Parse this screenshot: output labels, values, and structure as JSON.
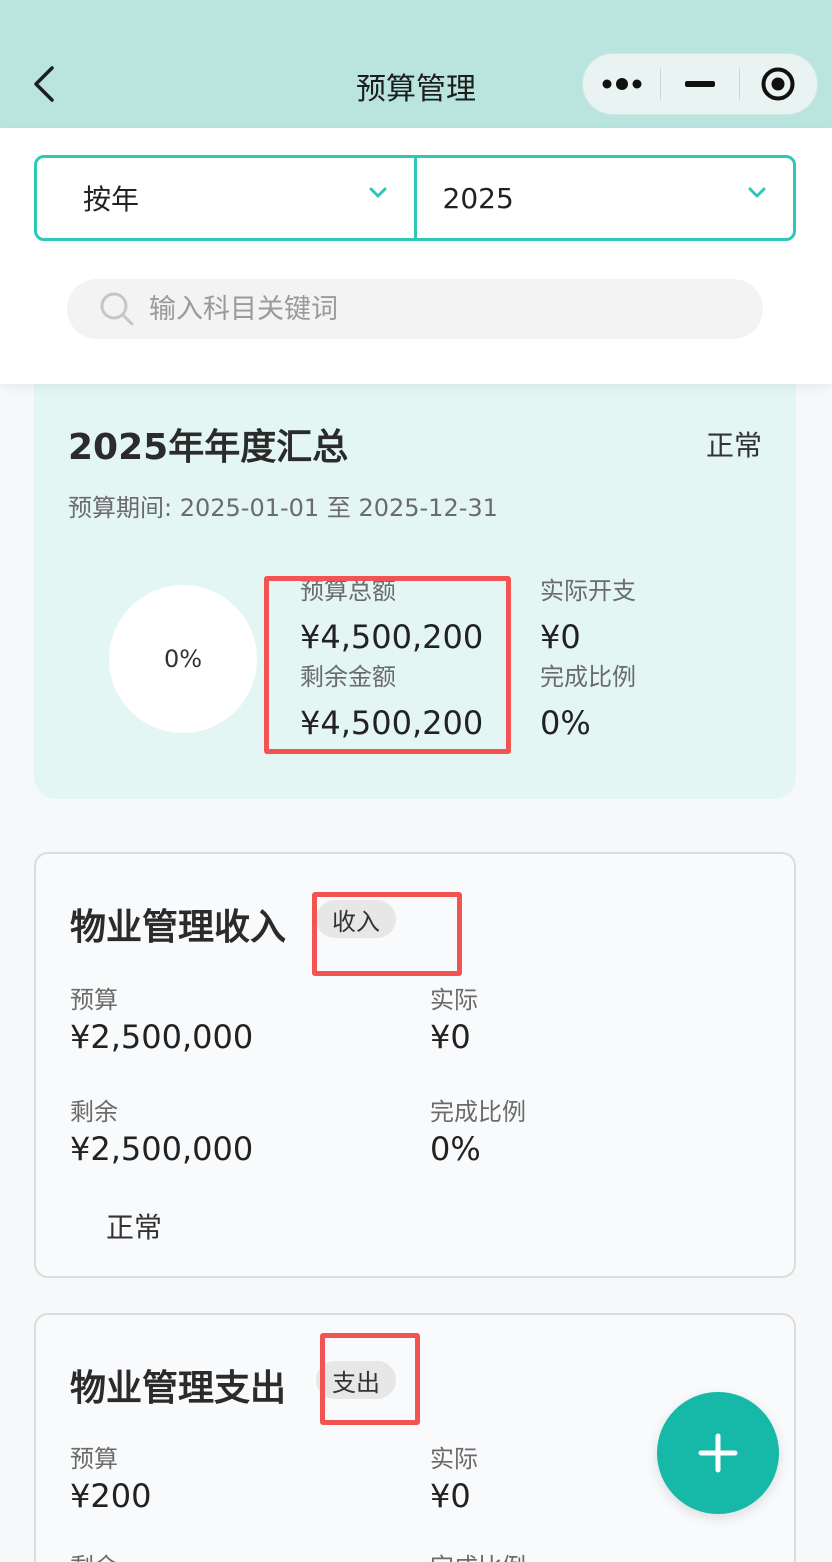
{
  "header": {
    "title": "预算管理"
  },
  "filter": {
    "period_type": "按年",
    "year": "2025",
    "search_placeholder": "输入科目关键词"
  },
  "summary": {
    "title": "2025年年度汇总",
    "status": "正常",
    "period": "预算期间: 2025-01-01 至 2025-12-31",
    "progress_text": "0%",
    "progress_fraction": 0,
    "stats": {
      "budget_total_label": "预算总额",
      "budget_total_value": "¥4,500,200",
      "actual_label": "实际开支",
      "actual_value": "¥0",
      "remaining_label": "剩余金额",
      "remaining_value": "¥4,500,200",
      "completion_label": "完成比例",
      "completion_value": "0%"
    }
  },
  "items": [
    {
      "title": "物业管理收入",
      "tag": "收入",
      "budget_label": "预算",
      "budget_value": "¥2,500,000",
      "actual_label": "实际",
      "actual_value": "¥0",
      "remaining_label": "剩余",
      "remaining_value": "¥2,500,000",
      "completion_label": "完成比例",
      "completion_value": "0%",
      "status": "正常"
    },
    {
      "title": "物业管理支出",
      "tag": "支出",
      "budget_label": "预算",
      "budget_value": "¥200",
      "actual_label": "实际",
      "actual_value": "¥0",
      "remaining_label": "剩余",
      "remaining_value": "",
      "completion_label": "完成比例",
      "completion_value": ""
    }
  ],
  "colors": {
    "accent": "#2cc9b7",
    "fab": "#16b8a8",
    "highlight": "#f25454",
    "header_bg": "#b9e5de",
    "summary_bg": "#e3f6f4"
  },
  "icons": {
    "back": "chevron-left-icon",
    "more": "more-dots-icon",
    "minimize": "minus-icon",
    "close": "target-circle-icon",
    "dropdown": "chevron-down-icon",
    "search": "search-icon",
    "add": "plus-icon"
  }
}
